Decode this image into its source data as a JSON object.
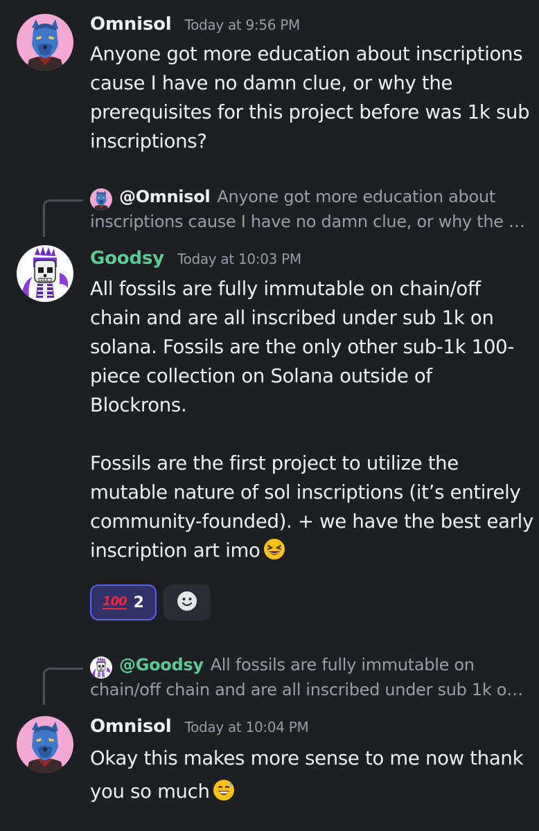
{
  "messages": [
    {
      "author": "Omnisol",
      "author_color": "#eef0f3",
      "timestamp": "Today at 9:56 PM",
      "paragraphs": [
        "Anyone got more education about inscriptions cause I have no damn clue, or why the prerequisites for this project before was 1k sub inscriptions?"
      ]
    },
    {
      "reply": {
        "mention": "@Omnisol",
        "preview": "Anyone got more education about inscriptions cause I have no damn clue, or why the …"
      },
      "author": "Goodsy",
      "author_color": "#5dc795",
      "timestamp": "Today at 10:03 PM",
      "paragraphs": [
        "All fossils are fully immutable on chain/off chain and are all inscribed under sub 1k on solana. Fossils are the only other sub-1k 100-piece collection on Solana outside of Blockrons.",
        "Fossils are the first project to utilize the mutable nature of sol inscriptions (it’s entirely community-founded). + we have the best early inscription art imo"
      ],
      "trailing_emoji": "laughing-face",
      "reactions": [
        {
          "emoji": "100",
          "emoji_name": "hundred-points-emoji",
          "count": "2",
          "active": true
        }
      ]
    },
    {
      "reply": {
        "mention": "@Goodsy",
        "preview": "All fossils are fully immutable on chain/off chain and are all inscribed under sub 1k o…"
      },
      "author": "Omnisol",
      "author_color": "#eef0f3",
      "timestamp": "Today at 10:04 PM",
      "paragraphs": [
        "Okay this makes more sense to me now thank you so much"
      ],
      "trailing_emoji": "grinning-sweat-face"
    }
  ],
  "colors": {
    "background": "#1e1f23",
    "accent": "#5a62f0",
    "goodsy_name": "#5dc795",
    "muted": "#9a9ca3"
  }
}
